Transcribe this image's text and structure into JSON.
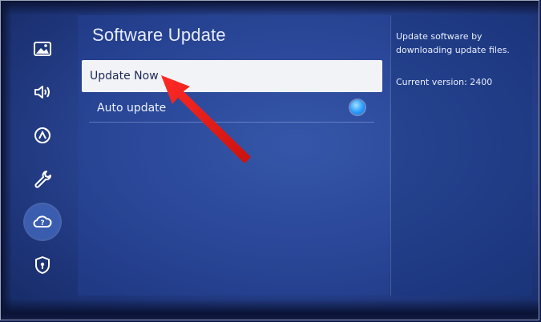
{
  "menu": {
    "title": "Software Update",
    "items": [
      {
        "label": "Update Now",
        "selected": true
      },
      {
        "label": "Auto update",
        "toggle": "on"
      }
    ]
  },
  "info": {
    "description": "Update software by downloading update files.",
    "current_version": "Current version: 2400"
  },
  "rail": {
    "items": [
      {
        "icon": "picture-icon"
      },
      {
        "icon": "sound-icon"
      },
      {
        "icon": "network-icon"
      },
      {
        "icon": "wrench-icon"
      },
      {
        "icon": "support-cloud-icon",
        "selected": true
      },
      {
        "icon": "privacy-shield-icon"
      }
    ]
  },
  "colors": {
    "background": "#2a4592",
    "selected_item": "#f2f3f7",
    "toggle_on": "#2a9cff",
    "annotation_arrow": "#e0201f"
  }
}
